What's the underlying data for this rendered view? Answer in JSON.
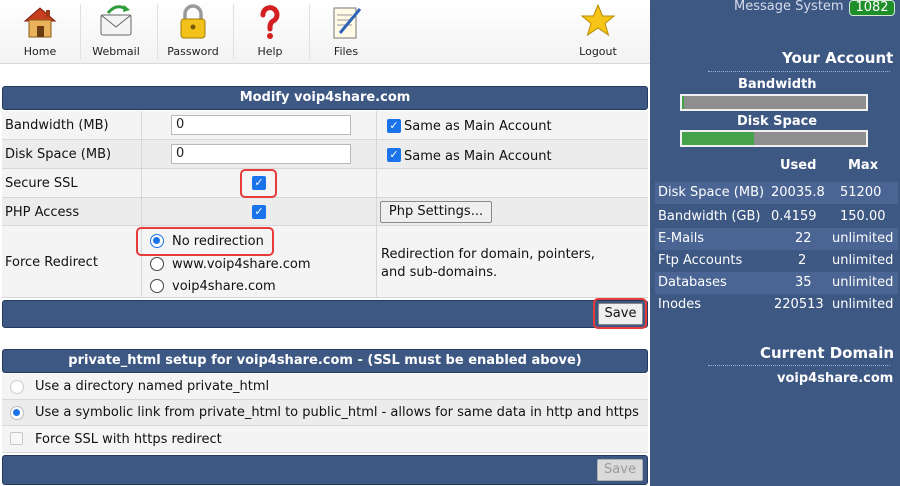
{
  "nav": {
    "items": [
      {
        "label": "Home",
        "icon": "home-icon"
      },
      {
        "label": "Webmail",
        "icon": "webmail-icon"
      },
      {
        "label": "Password",
        "icon": "padlock-icon"
      },
      {
        "label": "Help",
        "icon": "help-question-icon"
      },
      {
        "label": "Files",
        "icon": "files-icon"
      },
      {
        "label": "Logout",
        "icon": "star-logout-icon"
      }
    ]
  },
  "modify": {
    "title": "Modify voip4share.com",
    "bandwidth": {
      "label": "Bandwidth (MB)",
      "value": "0",
      "same_label": "Same as Main Account",
      "same_checked": true
    },
    "disk": {
      "label": "Disk Space (MB)",
      "value": "0",
      "same_label": "Same as Main Account",
      "same_checked": true
    },
    "ssl": {
      "label": "Secure SSL",
      "checked": true
    },
    "php": {
      "label": "PHP Access",
      "checked": true,
      "settings_button": "Php Settings..."
    },
    "redirect": {
      "label": "Force Redirect",
      "options": [
        "No redirection",
        "www.voip4share.com",
        "voip4share.com"
      ],
      "selected": "No redirection",
      "note": "Redirection for domain, pointers, and sub-domains."
    },
    "save_label": "Save"
  },
  "private_html": {
    "title": "private_html setup for voip4share.com - (SSL must be enabled above)",
    "options": [
      "Use a directory named private_html",
      "Use a symbolic link from private_html to public_html - allows for same data in http and https"
    ],
    "selected": "Use a symbolic link from private_html to public_html - allows for same data in http and https",
    "force_ssl_label": "Force SSL with https redirect",
    "save_label": "Save"
  },
  "sidebar": {
    "message_label": "Message System",
    "message_count": "1082",
    "account_title": "Your Account",
    "bandwidth_label": "Bandwidth",
    "bandwidth_fraction": 0.01,
    "disk_label": "Disk Space",
    "disk_fraction": 0.39,
    "col_used": "Used",
    "col_max": "Max",
    "stats": [
      {
        "name": "Disk Space (MB)",
        "used": "20035.8",
        "max": "51200"
      },
      {
        "name": "Bandwidth (GB)",
        "used": "0.4159",
        "max": "150.00"
      },
      {
        "name": "E-Mails",
        "used": "22",
        "max": "unlimited"
      },
      {
        "name": "Ftp Accounts",
        "used": "2",
        "max": "unlimited"
      },
      {
        "name": "Databases",
        "used": "35",
        "max": "unlimited"
      },
      {
        "name": "Inodes",
        "used": "220513",
        "max": "unlimited"
      }
    ],
    "domain_title": "Current Domain",
    "domain": "voip4share.com"
  },
  "colors": {
    "panel": "#3e5884",
    "highlight": "#e53b3b",
    "checkbox": "#1a73e8",
    "bar_fill": "#46a14b",
    "badge": "#1f8f2a"
  }
}
